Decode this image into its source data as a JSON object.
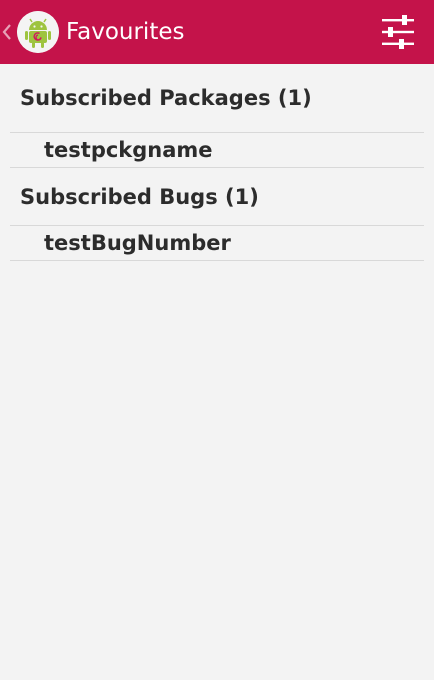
{
  "actionbar": {
    "title": "Favourites",
    "back_icon": "chevron-left-icon",
    "app_icon": "android-debian-icon",
    "settings_icon": "sliders-icon",
    "color": "#c4134a"
  },
  "sections": [
    {
      "header": "Subscribed Packages (1)",
      "items": [
        "testpckgname"
      ]
    },
    {
      "header": "Subscribed Bugs (1)",
      "items": [
        "testBugNumber"
      ]
    }
  ]
}
